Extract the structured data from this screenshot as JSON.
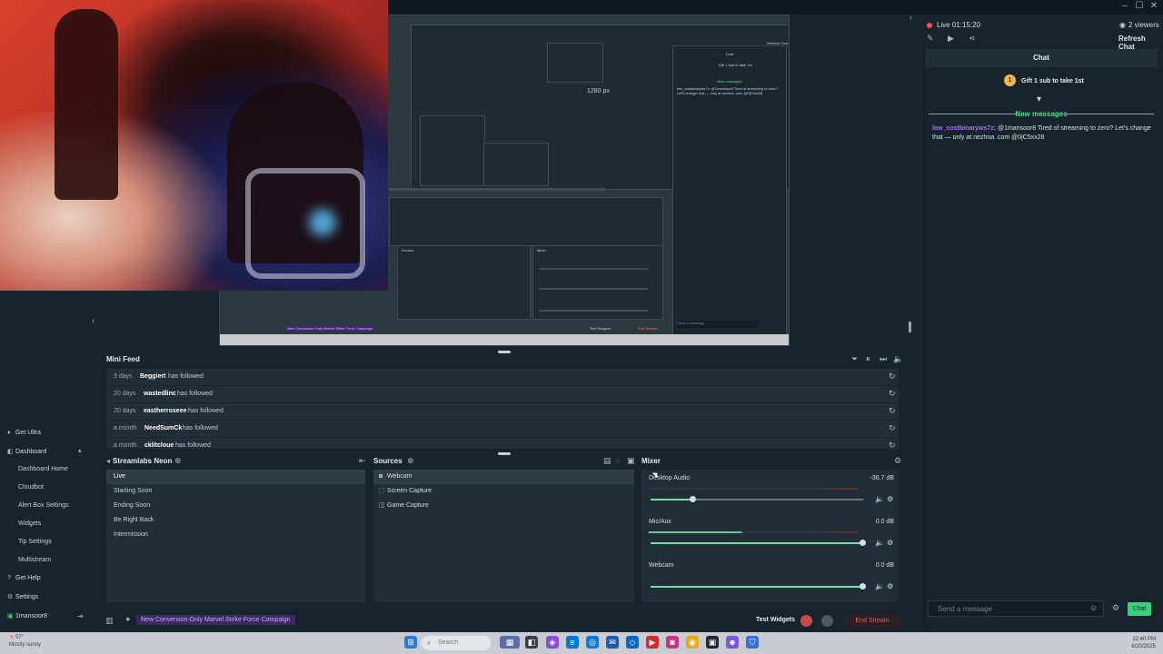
{
  "window": {
    "minimize": "–",
    "maximize": "☐",
    "close": "✕"
  },
  "preview": {
    "resolution_label": "1280 px",
    "inner_chat_header": "Chat",
    "inner_gift": "Gift 1 sub to take 1st",
    "inner_new_messages": "New messages",
    "inner_message": "low_costbinaryws7z: @1mansoor8 Tired of streaming to zero? Let's change that — only at nezhna .com @0jC5xx28",
    "inner_campaign": "New Conversion-Only Marvel Strike Force Campaign",
    "inner_scenes_title": "Scenes",
    "inner_mixer_title": "Mixer",
    "inner_send": "Send a message",
    "inner_test_widgets": "Test Widgets",
    "inner_end_stream": "End Stream",
    "inner_refresh_chat": "Refresh Chat"
  },
  "live": {
    "status": "Live 01:15:20",
    "viewers": "2 viewers",
    "refresh_chat": "Refresh Chat"
  },
  "chat": {
    "title": "Chat",
    "gift_badge": "1",
    "gift_text": "Gift 1 sub to take 1st",
    "new_messages": "New messages",
    "message": {
      "user": "low_costbinaryws7z:",
      "text": " @1mansoor8 Tired of streaming to zero? Let's change that — only at nezhna .com @0jC5xx28"
    },
    "input_placeholder": "Send a message",
    "send_label": "Chat"
  },
  "sidebar": {
    "get_ultra": "Get Ultra",
    "dashboard": "Dashboard",
    "sub_items": [
      "Dashboard Home",
      "Cloudbot",
      "Alert Box Settings",
      "Widgets",
      "Tip Settings",
      "Multistream"
    ],
    "get_help": "Get Help",
    "settings": "Settings",
    "user": "1mansoor8"
  },
  "mini_feed": {
    "title": "Mini Feed",
    "items": [
      {
        "age": "3 days",
        "user": "Beggiert",
        "action": "has followed"
      },
      {
        "age": "20 days",
        "user": "wastedlinc",
        "action": "has followed"
      },
      {
        "age": "20 days",
        "user": "eastherroseee",
        "action": "has followed"
      },
      {
        "age": "a month",
        "user": "NeedSumCk",
        "action": "has followed"
      },
      {
        "age": "a month",
        "user": "cklitcloue",
        "action": "has followed"
      }
    ]
  },
  "scenes": {
    "title": "Streamlabs Neon",
    "items": [
      "Live",
      "Starting Soon",
      "Ending Soon",
      "Be Right Back",
      "Intermission"
    ]
  },
  "sources": {
    "title": "Sources",
    "items": [
      {
        "label": "Webcam",
        "icon": "webcam-icon"
      },
      {
        "label": "Screen Capture",
        "icon": "screen-capture-icon"
      },
      {
        "label": "Game Capture",
        "icon": "gamepad-icon"
      }
    ]
  },
  "mixer": {
    "title": "Mixer",
    "channels": [
      {
        "name": "Desktop Audio",
        "db": "-36.7 dB",
        "level": 0.2
      },
      {
        "name": "Mic/Aux",
        "db": "0.0 dB",
        "level": 1.0
      },
      {
        "name": "Webcam",
        "db": "0.0 dB",
        "level": 1.0
      }
    ]
  },
  "bottom": {
    "campaign": "New Conversion-Only Marvel Strike Force Campaign",
    "test_widgets": "Test Widgets",
    "end_stream": "End Stream"
  },
  "taskbar": {
    "weather_temp": "57°",
    "weather_desc": "Mostly sunny",
    "search_placeholder": "Search",
    "time": "12:40 PM",
    "date": "6/20/2025"
  },
  "colors": {
    "accent_green": "#38d17b",
    "live_red": "#ff4d4d",
    "chat_user": "#b26cff",
    "end_stream_red": "#ff5a5a"
  }
}
